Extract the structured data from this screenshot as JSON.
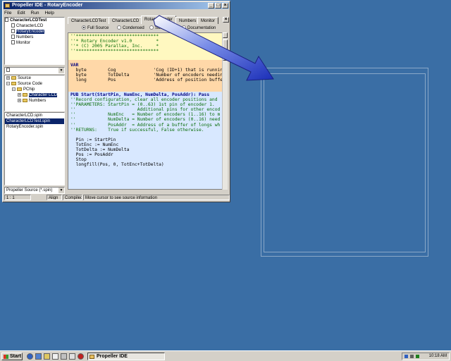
{
  "window": {
    "title": "Propeller IDE - RotaryEncoder",
    "controls": [
      "_",
      "□",
      "×"
    ]
  },
  "menu": [
    "File",
    "Edit",
    "Run",
    "Help"
  ],
  "object_tree": {
    "root": "CharacterLCDTest",
    "items": [
      "CharacterLCD",
      "RotaryEncoder",
      "Numbers",
      "Monitor"
    ],
    "selected": "RotaryEncoder"
  },
  "folder_tree": {
    "drive": "",
    "items": [
      "Source",
      "Source Code",
      "PChip",
      "Character LCD",
      "Numbers"
    ]
  },
  "file_list": [
    "CharacterLCD.spin",
    "CharacterLCDTest.spin",
    "RotaryEncoder.spin"
  ],
  "file_filter": "Propeller Source (*.spin)",
  "tabs": [
    "CharacterLCDTest",
    "CharacterLCD",
    "RotaryEncoder",
    "Numbers",
    "Monitor"
  ],
  "active_tab": "RotaryEncoder",
  "view_modes": [
    "Full Source",
    "Condensed",
    "Summary",
    "Documentation"
  ],
  "code": {
    "con": [
      "''*******************************",
      "''* Rotary Encoder v1.0         *",
      "''* (C) 2005 Parallax, Inc.     *",
      "''*******************************"
    ],
    "var": [
      "VAR",
      "  byte        Cog              'Cog (ID+1) that is running",
      "  byte        TotDelta         'Number of encoders needing",
      "  long        Pos              'Address of position buffer"
    ],
    "pub": [
      "PUB Start(StartPin, NumEnc, NumDelta, PosAddr): Pass",
      "''Record configuration, clear all encoder positions and",
      "''PARAMETERS: StartPin = (0..63) 1st pin of encoder 1.",
      "''                       Additional pins for other encod",
      "''            NumEnc   = Number of encoders (1..16) to m",
      "''            NumDelta = Number of encoders (0..16) need",
      "''            PosAddr  = Address of a buffer of longs wh",
      "''RETURNS:    True if successful, False otherwise.",
      "",
      "  Pin := StartPin",
      "  TotEnc := NumEnc",
      "  TotDelta := NumDelta",
      "  Pos := PosAddr",
      "  Stop",
      "  longfill(Pos, 0, TotEnc+TotDelta)"
    ]
  },
  "status": {
    "position": "1 : 1",
    "align": "Align",
    "compiled": "Compiled",
    "hint": "Move cursor to see source information"
  },
  "taskbar": {
    "start": "Start",
    "task": "Propeller IDE",
    "clock": "10:18 AM"
  },
  "colors": {
    "desktop": "#3a6ea5",
    "con_block": "#fff8c0",
    "var_block": "#ffd8a8",
    "pub_block": "#d8e8ff",
    "arrow": "#2a3ec8"
  }
}
